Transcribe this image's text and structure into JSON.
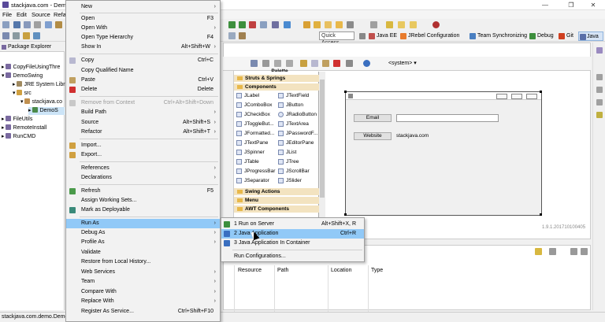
{
  "window": {
    "title": "stackjava.com - DemoS",
    "minimize": "—",
    "maximize": "❐",
    "close": "✕"
  },
  "menubar": [
    "File",
    "Edit",
    "Source",
    "Refa"
  ],
  "quick_access": "Quick Access",
  "perspectives": [
    {
      "label": "Java EE",
      "color": "#c0504d"
    },
    {
      "label": "JRebel Configuration",
      "color": "#e87b2c"
    },
    {
      "label": "Team Synchronizing",
      "color": "#4a7fc1"
    },
    {
      "label": "Debug",
      "color": "#3d8f3d"
    },
    {
      "label": "Git",
      "color": "#d04020"
    },
    {
      "label": "Java",
      "color": "#5a6fa8",
      "active": true
    }
  ],
  "package_explorer": {
    "tab": "Package Explorer",
    "items": [
      {
        "label": "CopyFileUsingThre",
        "indent": 0,
        "expanded": false
      },
      {
        "label": "DemoSwing",
        "indent": 0,
        "expanded": true
      },
      {
        "label": "JRE System Libr",
        "indent": 1
      },
      {
        "label": "src",
        "indent": 1,
        "expanded": true
      },
      {
        "label": "stackjava.co",
        "indent": 2,
        "expanded": true
      },
      {
        "label": "DemoS",
        "indent": 3,
        "selected": true
      },
      {
        "label": "FileUtils",
        "indent": 0
      },
      {
        "label": "RemoteInstall",
        "indent": 0
      },
      {
        "label": "RunCMD",
        "indent": 0
      }
    ]
  },
  "context_menu": [
    {
      "label": "New",
      "arrow": true
    },
    {
      "sep": true
    },
    {
      "label": "Open",
      "shortcut": "F3"
    },
    {
      "label": "Open With",
      "arrow": true
    },
    {
      "label": "Open Type Hierarchy",
      "shortcut": "F4"
    },
    {
      "label": "Show In",
      "shortcut": "Alt+Shift+W",
      "arrow": true
    },
    {
      "sep": true
    },
    {
      "label": "Copy",
      "shortcut": "Ctrl+C",
      "icon": true
    },
    {
      "label": "Copy Qualified Name"
    },
    {
      "label": "Paste",
      "shortcut": "Ctrl+V",
      "icon": true
    },
    {
      "label": "Delete",
      "shortcut": "Delete",
      "icon": true
    },
    {
      "sep": true
    },
    {
      "label": "Remove from Context",
      "shortcut": "Ctrl+Alt+Shift+Down",
      "disabled": true,
      "icon": true
    },
    {
      "label": "Build Path",
      "arrow": true
    },
    {
      "label": "Source",
      "shortcut": "Alt+Shift+S",
      "arrow": true
    },
    {
      "label": "Refactor",
      "shortcut": "Alt+Shift+T",
      "arrow": true
    },
    {
      "sep": true
    },
    {
      "label": "Import...",
      "icon": true
    },
    {
      "label": "Export...",
      "icon": true
    },
    {
      "sep": true
    },
    {
      "label": "References",
      "arrow": true
    },
    {
      "label": "Declarations",
      "arrow": true
    },
    {
      "sep": true
    },
    {
      "label": "Refresh",
      "shortcut": "F5",
      "icon": true
    },
    {
      "label": "Assign Working Sets..."
    },
    {
      "label": "Mark as Deployable",
      "icon": true
    },
    {
      "sep": true
    },
    {
      "label": "Run As",
      "arrow": true,
      "highlight": true
    },
    {
      "label": "Debug As",
      "arrow": true
    },
    {
      "label": "Profile As",
      "arrow": true
    },
    {
      "label": "Validate"
    },
    {
      "label": "Restore from Local History..."
    },
    {
      "label": "Web Services",
      "arrow": true
    },
    {
      "label": "Team",
      "arrow": true
    },
    {
      "label": "Compare With",
      "arrow": true
    },
    {
      "label": "Replace With",
      "arrow": true
    },
    {
      "label": "Register As Service...",
      "shortcut": "Ctrl+Shift+F10"
    }
  ],
  "run_as_submenu": [
    {
      "label": "1 Run on Server",
      "shortcut": "Alt+Shift+X, R",
      "color": "#3d8f3d"
    },
    {
      "label": "2 Java Application",
      "shortcut": "Ctrl+R",
      "color": "#3a6fc0",
      "highlight": true
    },
    {
      "label": "3 Java Application In Container",
      "color": "#3a6fc0"
    },
    {
      "sep": true
    },
    {
      "label": "Run Configurations..."
    }
  ],
  "editor": {
    "system_combo": "<system>",
    "palette_title": "Palette",
    "palette": [
      {
        "type": "header",
        "label": "Struts & Springs"
      },
      {
        "type": "header",
        "label": "Components"
      },
      {
        "type": "row",
        "left": "JLabel",
        "right": "JTextField"
      },
      {
        "type": "row",
        "left": "JComboBox",
        "right": "JButton"
      },
      {
        "type": "row",
        "left": "JCheckBox",
        "right": "JRadioButton"
      },
      {
        "type": "row",
        "left": "JToggleBut...",
        "right": "JTextArea"
      },
      {
        "type": "row",
        "left": "JFormatted...",
        "right": "JPasswordF..."
      },
      {
        "type": "row",
        "left": "JTextPane",
        "right": "JEditorPane"
      },
      {
        "type": "row",
        "left": "JSpinner",
        "right": "JList"
      },
      {
        "type": "row",
        "left": "JTable",
        "right": "JTree"
      },
      {
        "type": "row",
        "left": "JProgressBar",
        "right": "JScrollBar"
      },
      {
        "type": "row",
        "left": "JSeparator",
        "right": "JSlider"
      },
      {
        "type": "header",
        "label": "Swing Actions"
      },
      {
        "type": "header",
        "label": "Menu"
      },
      {
        "type": "header",
        "label": "AWT Components"
      }
    ],
    "form": {
      "email_button": "Email",
      "email_value": "",
      "website_button": "Website",
      "website_label": "stackjava.com"
    },
    "version": "1.9.1.201710100405"
  },
  "bottom_panel": {
    "columns": [
      "Resource",
      "Path",
      "Location",
      "Type"
    ]
  },
  "status": "stackjava.com.demo.Demo"
}
